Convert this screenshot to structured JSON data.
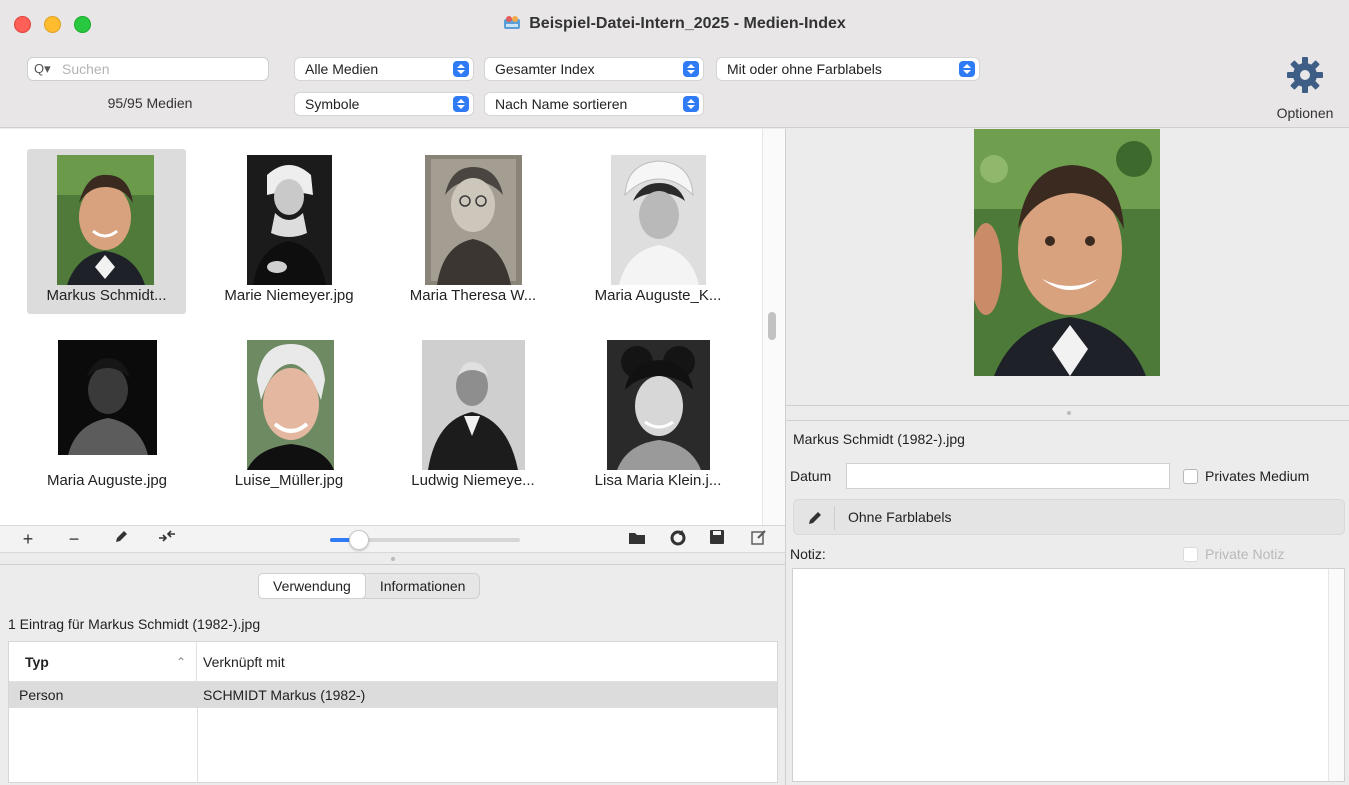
{
  "window": {
    "title": "Beispiel-Datei-Intern_2025 - Medien-Index"
  },
  "toolbar": {
    "search_placeholder": "Suchen",
    "count": "95/95 Medien",
    "filter_media": "Alle Medien",
    "filter_index": "Gesamter Index",
    "filter_labels": "Mit oder ohne Farblabels",
    "view_mode": "Symbole",
    "sort": "Nach Name sortieren",
    "options_label": "Optionen"
  },
  "grid": {
    "items": [
      {
        "caption": "Markus Schmidt...",
        "selected": true
      },
      {
        "caption": "Marie Niemeyer.jpg"
      },
      {
        "caption": "Maria Theresa W..."
      },
      {
        "caption": "Maria Auguste_K..."
      },
      {
        "caption": "Maria Auguste.jpg"
      },
      {
        "caption": "Luise_Müller.jpg"
      },
      {
        "caption": "Ludwig Niemeye..."
      },
      {
        "caption": "Lisa Maria Klein.j..."
      }
    ],
    "zoom_fraction": 0.15
  },
  "usage": {
    "tab_usage": "Verwendung",
    "tab_info": "Informationen",
    "entry_label": "1 Eintrag für Markus Schmidt (1982-).jpg",
    "col_type": "Typ",
    "col_linked": "Verknüpft mit",
    "rows": [
      {
        "type": "Person",
        "linked": "SCHMIDT Markus (1982-)"
      }
    ]
  },
  "details": {
    "filename": "Markus Schmidt (1982-).jpg",
    "date_label": "Datum",
    "date_value": "",
    "private_media_label": "Privates Medium",
    "color_label": "Ohne Farblabels",
    "note_label": "Notiz:",
    "private_note_label": "Private Notiz"
  },
  "colors": {
    "accent": "#2f7bf5",
    "selection": "#dcdcdc"
  }
}
